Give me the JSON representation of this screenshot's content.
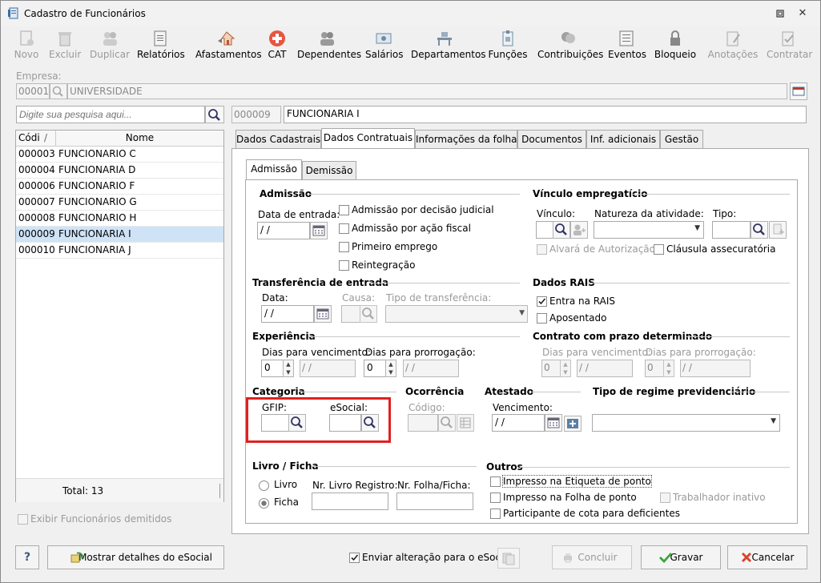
{
  "window": {
    "title": "Cadastro de Funcionários"
  },
  "toolbar": {
    "novo": "Novo",
    "excluir": "Excluir",
    "duplicar": "Duplicar",
    "relatorios": "Relatórios",
    "afastamentos": "Afastamentos",
    "cat": "CAT",
    "dependentes": "Dependentes",
    "salarios": "Salários",
    "departamentos": "Departamentos",
    "funcoes": "Funções",
    "contribuicoes": "Contribuições",
    "eventos": "Eventos",
    "bloqueio": "Bloqueio",
    "anotacoes": "Anotações",
    "contratar": "Contratar"
  },
  "empresa": {
    "label": "Empresa:",
    "code": "00001",
    "name": "UNIVERSIDADE"
  },
  "search": {
    "placeholder": "Digite sua pesquisa aqui..."
  },
  "employee": {
    "code": "000009",
    "name": "FUNCIONARIA I"
  },
  "list": {
    "col_code": "Códi",
    "col_sort": "/",
    "col_name": "Nome",
    "rows": [
      {
        "code": "000003",
        "name": "FUNCIONARIO C"
      },
      {
        "code": "000004",
        "name": "FUNCIONARIA D"
      },
      {
        "code": "000006",
        "name": "FUNCIONARIO F"
      },
      {
        "code": "000007",
        "name": "FUNCIONARIO G"
      },
      {
        "code": "000008",
        "name": "FUNCIONARIO H"
      },
      {
        "code": "000009",
        "name": "FUNCIONARIA I"
      },
      {
        "code": "000010",
        "name": "FUNCIONARIA J"
      }
    ],
    "total": "Total: 13"
  },
  "exibir_demitidos": "Exibir Funcionários demitidos",
  "tabs": [
    "Dados Cadastrais",
    "Dados Contratuais",
    "Informações da folha",
    "Documentos",
    "Inf. adicionais",
    "Gestão"
  ],
  "subtabs": [
    "Admissão",
    "Demissão"
  ],
  "admissao": {
    "title": "Admissão",
    "data_label": "Data de entrada:",
    "data_value": " / /",
    "cb_judicial": "Admissão por decisão judicial",
    "cb_fiscal": "Admissão por ação fiscal",
    "cb_primeiro": "Primeiro emprego",
    "cb_reintegracao": "Reintegração"
  },
  "vinculo": {
    "title": "Vínculo empregatício",
    "vinculo_label": "Vínculo:",
    "natureza_label": "Natureza da atividade:",
    "tipo_label": "Tipo:",
    "alvara": "Alvará de Autorização",
    "clausula": "Cláusula assecuratória"
  },
  "transferencia": {
    "title": "Transferência de entrada",
    "data_label": "Data:",
    "data_value": " / /",
    "causa_label": "Causa:",
    "tipo_label": "Tipo de transferência:"
  },
  "rais": {
    "title": "Dados RAIS",
    "entra": "Entra na RAIS",
    "aposentado": "Aposentado"
  },
  "experiencia": {
    "title": "Experiência",
    "dias_venc": "Dias para vencimento:",
    "dias_prorr": "Dias para prorrogação:",
    "venc_value": "0",
    "venc_date": " / /",
    "prorr_value": "0",
    "prorr_date": " / /"
  },
  "contrato": {
    "title": "Contrato com prazo determinado",
    "dias_venc": "Dias para vencimento:",
    "dias_prorr": "Dias para prorrogação:",
    "venc_value": "0",
    "venc_date": " / /",
    "prorr_value": "0",
    "prorr_date": " / /"
  },
  "categoria": {
    "title": "Categoria",
    "gfip": "GFIP:",
    "esocial": "eSocial:"
  },
  "ocorrencia": {
    "title": "Ocorrência",
    "codigo": "Código:"
  },
  "atestado": {
    "title": "Atestado",
    "vencimento": "Vencimento:",
    "value": " / /"
  },
  "regime": {
    "title": "Tipo de regime previdenciário"
  },
  "livro": {
    "title": "Livro / Ficha",
    "livro": "Livro",
    "ficha": "Ficha",
    "nr_livro": "Nr. Livro Registro:",
    "nr_folha": "Nr. Folha/Ficha:"
  },
  "outros": {
    "title": "Outros",
    "etiqueta": "Impresso na Etiqueta de ponto",
    "folha": "Impresso na Folha de ponto",
    "cota": "Participante de cota para deficientes",
    "inativo": "Trabalhador inativo"
  },
  "bottom": {
    "help": "?",
    "detalhes": "Mostrar detalhes do eSocial",
    "enviar": "Enviar alteração para o eSocial",
    "concluir": "Concluir",
    "gravar": "Gravar",
    "cancelar": "Cancelar"
  },
  "colors": {
    "highlight": "#e02020",
    "selection": "#cfe3f7",
    "cat_red": "#e8553f"
  }
}
